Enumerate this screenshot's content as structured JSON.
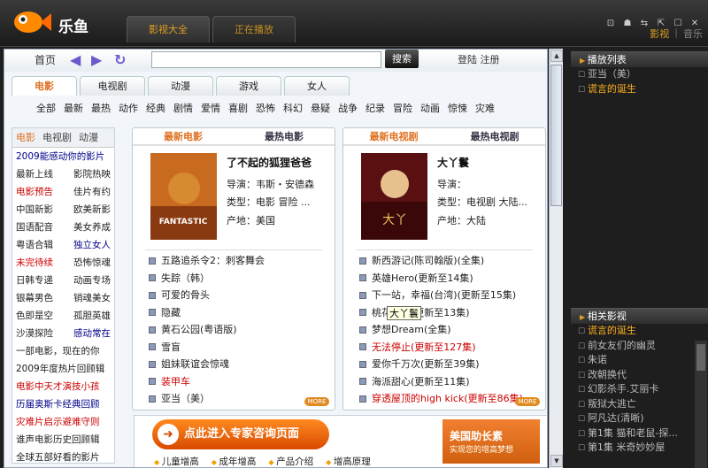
{
  "app": {
    "name": "乐鱼"
  },
  "top_tabs": [
    "影视大全",
    "正在播放"
  ],
  "top_nav": {
    "video": "影视",
    "music": "音乐"
  },
  "window_buttons": [
    "⊡",
    "☗",
    "⇆",
    "⇱",
    "☐",
    "✕"
  ],
  "nav": {
    "home": "首页",
    "search_button": "搜索",
    "login": "登陆",
    "register": "注册"
  },
  "categories": [
    "电影",
    "电视剧",
    "动漫",
    "游戏",
    "女人"
  ],
  "genres": [
    "全部",
    "最新",
    "最热",
    "动作",
    "经典",
    "剧情",
    "爱情",
    "喜剧",
    "恐怖",
    "科幻",
    "悬疑",
    "战争",
    "纪录",
    "冒险",
    "动画",
    "惊悚",
    "灾难"
  ],
  "left_panel": {
    "tabs": [
      "电影",
      "电视剧",
      "动漫"
    ],
    "rows": [
      [
        "2009能感动你的影片",
        ""
      ],
      [
        "最新上线",
        "影院热映"
      ],
      [
        "电影预告",
        "佳片有约"
      ],
      [
        "中国新影",
        "欧美新影"
      ],
      [
        "国语配音",
        "美女养成"
      ],
      [
        "粤语合辑",
        "独立女人"
      ],
      [
        "未完待续",
        "恐怖惊魂"
      ],
      [
        "日韩专递",
        "动画专场"
      ],
      [
        "银幕男色",
        "销魂美女"
      ],
      [
        "色即是空",
        "孤胆英雄"
      ],
      [
        "沙漠探险",
        "感动常在"
      ],
      [
        "一部电影，现在的你",
        ""
      ],
      [
        "2009年度热片回顾辑",
        ""
      ],
      [
        "电影中天才演技小孩",
        ""
      ],
      [
        "历届奥斯卡经典回顾",
        ""
      ],
      [
        "灾难片启示避难守则",
        ""
      ],
      [
        "谁声电影历史回顾辑",
        ""
      ],
      [
        "全球五部好看的影片",
        ""
      ]
    ]
  },
  "movie_panel": {
    "tab_new": "最新电影",
    "tab_hot": "最热电影",
    "title": "了不起的狐狸爸爸",
    "director": "导演：韦斯・安德森",
    "type": "类型：电影  冒险 ...",
    "region": "产地：美国",
    "items": [
      "五路追杀令2：刺客舞会",
      "失踪（韩）",
      "可爱的骨头",
      "隐藏",
      "黄石公园(粤语版)",
      "雪盲",
      "姐妹联谊会惊魂",
      "装甲车",
      "亚当（美）"
    ]
  },
  "tv_panel": {
    "tab_new": "最新电视剧",
    "tab_hot": "最热电视剧",
    "title": "大丫鬟",
    "director": "导演：",
    "type": "类型：电视剧  大陆...",
    "region": "产地：大陆",
    "items": [
      "新西游记(陈司翰版)(全集)",
      "英雄Hero(更新至14集)",
      "下一站，幸福(台湾)(更新至15集)",
      "桃花小妹(更新至13集)",
      "梦想Dream(全集)",
      "无法停止(更新至127集)",
      "爱你千万次(更新至39集)",
      "海派甜心(更新至11集)",
      "穿透屋顶的high kick(更新至86集)"
    ]
  },
  "tooltip": "大丫鬟",
  "more": "MORE",
  "banner": {
    "button": "点此进入专家咨询页面",
    "ad_title": "美国助长素",
    "ad_sub": "实现您的增高梦想",
    "links": [
      "儿童增高",
      "成年增高",
      "产品介绍",
      "增高原理"
    ]
  },
  "playlist": {
    "title": "播放列表",
    "items": [
      "亚当（美）",
      "谎言的诞生"
    ]
  },
  "related": {
    "title": "相关影视",
    "items": [
      "谎言的诞生",
      "前女友们的幽灵",
      "朱诺",
      "改朝换代",
      "幻影杀手.艾丽卡",
      "叛狱大逃亡",
      "阿凡达(清晰)",
      "第1集 猫和老鼠-探...",
      "第1集 米奇妙妙屋"
    ]
  }
}
